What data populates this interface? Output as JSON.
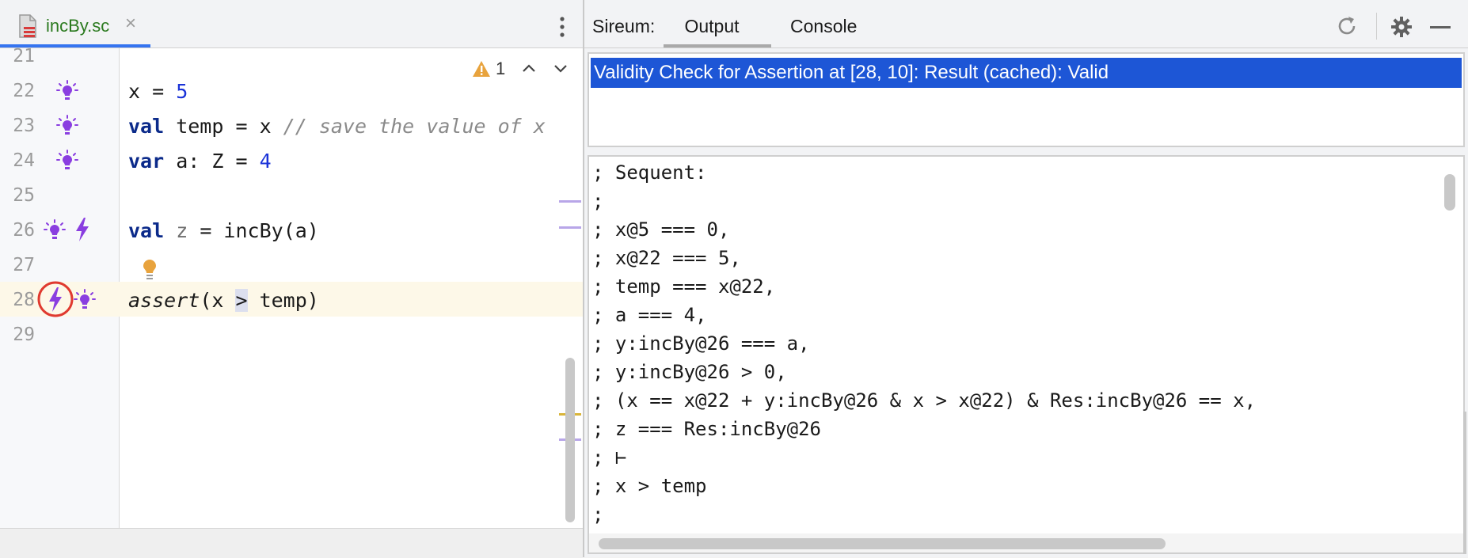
{
  "editor": {
    "tab_label": "incBy.sc",
    "tab_close": "×",
    "warning_count": "1",
    "lines": [
      {
        "num": "21"
      },
      {
        "num": "22"
      },
      {
        "num": "23"
      },
      {
        "num": "24"
      },
      {
        "num": "25"
      },
      {
        "num": "26"
      },
      {
        "num": "27"
      },
      {
        "num": "28"
      },
      {
        "num": "29"
      }
    ],
    "code": {
      "l22": {
        "a": "x = ",
        "b": "5"
      },
      "l23": {
        "kw": "val",
        "a": " temp = x ",
        "cmt": "// save the value of x"
      },
      "l24": {
        "kw": "var",
        "a": " a: Z = ",
        "b": "4"
      },
      "l26": {
        "kw": "val",
        "a": " ",
        "dim": "z",
        "b": " = incBy(a)"
      },
      "l28": {
        "fn": "assert",
        "a": "(x ",
        "op": ">",
        "b": " temp)"
      }
    }
  },
  "panel": {
    "title": "Sireum:",
    "tabs": [
      {
        "label": "Output"
      },
      {
        "label": "Console"
      }
    ],
    "result": "Validity Check for Assertion at [28, 10]: Result (cached): Valid",
    "detail": [
      "; Sequent:",
      ";",
      "; x@5 === 0,",
      "; x@22 === 5,",
      "; temp === x@22,",
      "; a === 4,",
      "; y:incBy@26 === a,",
      "; y:incBy@26 > 0,",
      "; (x == x@22 + y:incBy@26 & x > x@22) & Res:incBy@26 == x,",
      "; z === Res:incBy@26",
      "; ⊢",
      "; x > temp",
      ";"
    ]
  },
  "colors": {
    "accent": "#3574f0",
    "selection": "#1d56d6",
    "verify_icon": "#8a3ee0",
    "warning": "#e8a33d",
    "highlight_circle": "#e03a2f"
  },
  "icons": [
    "file-icon",
    "close-icon",
    "more-icon",
    "warning-icon",
    "chevron-up-icon",
    "chevron-down-icon",
    "bulb-icon",
    "lightning-icon",
    "refresh-icon",
    "gear-icon",
    "minimize-icon"
  ]
}
